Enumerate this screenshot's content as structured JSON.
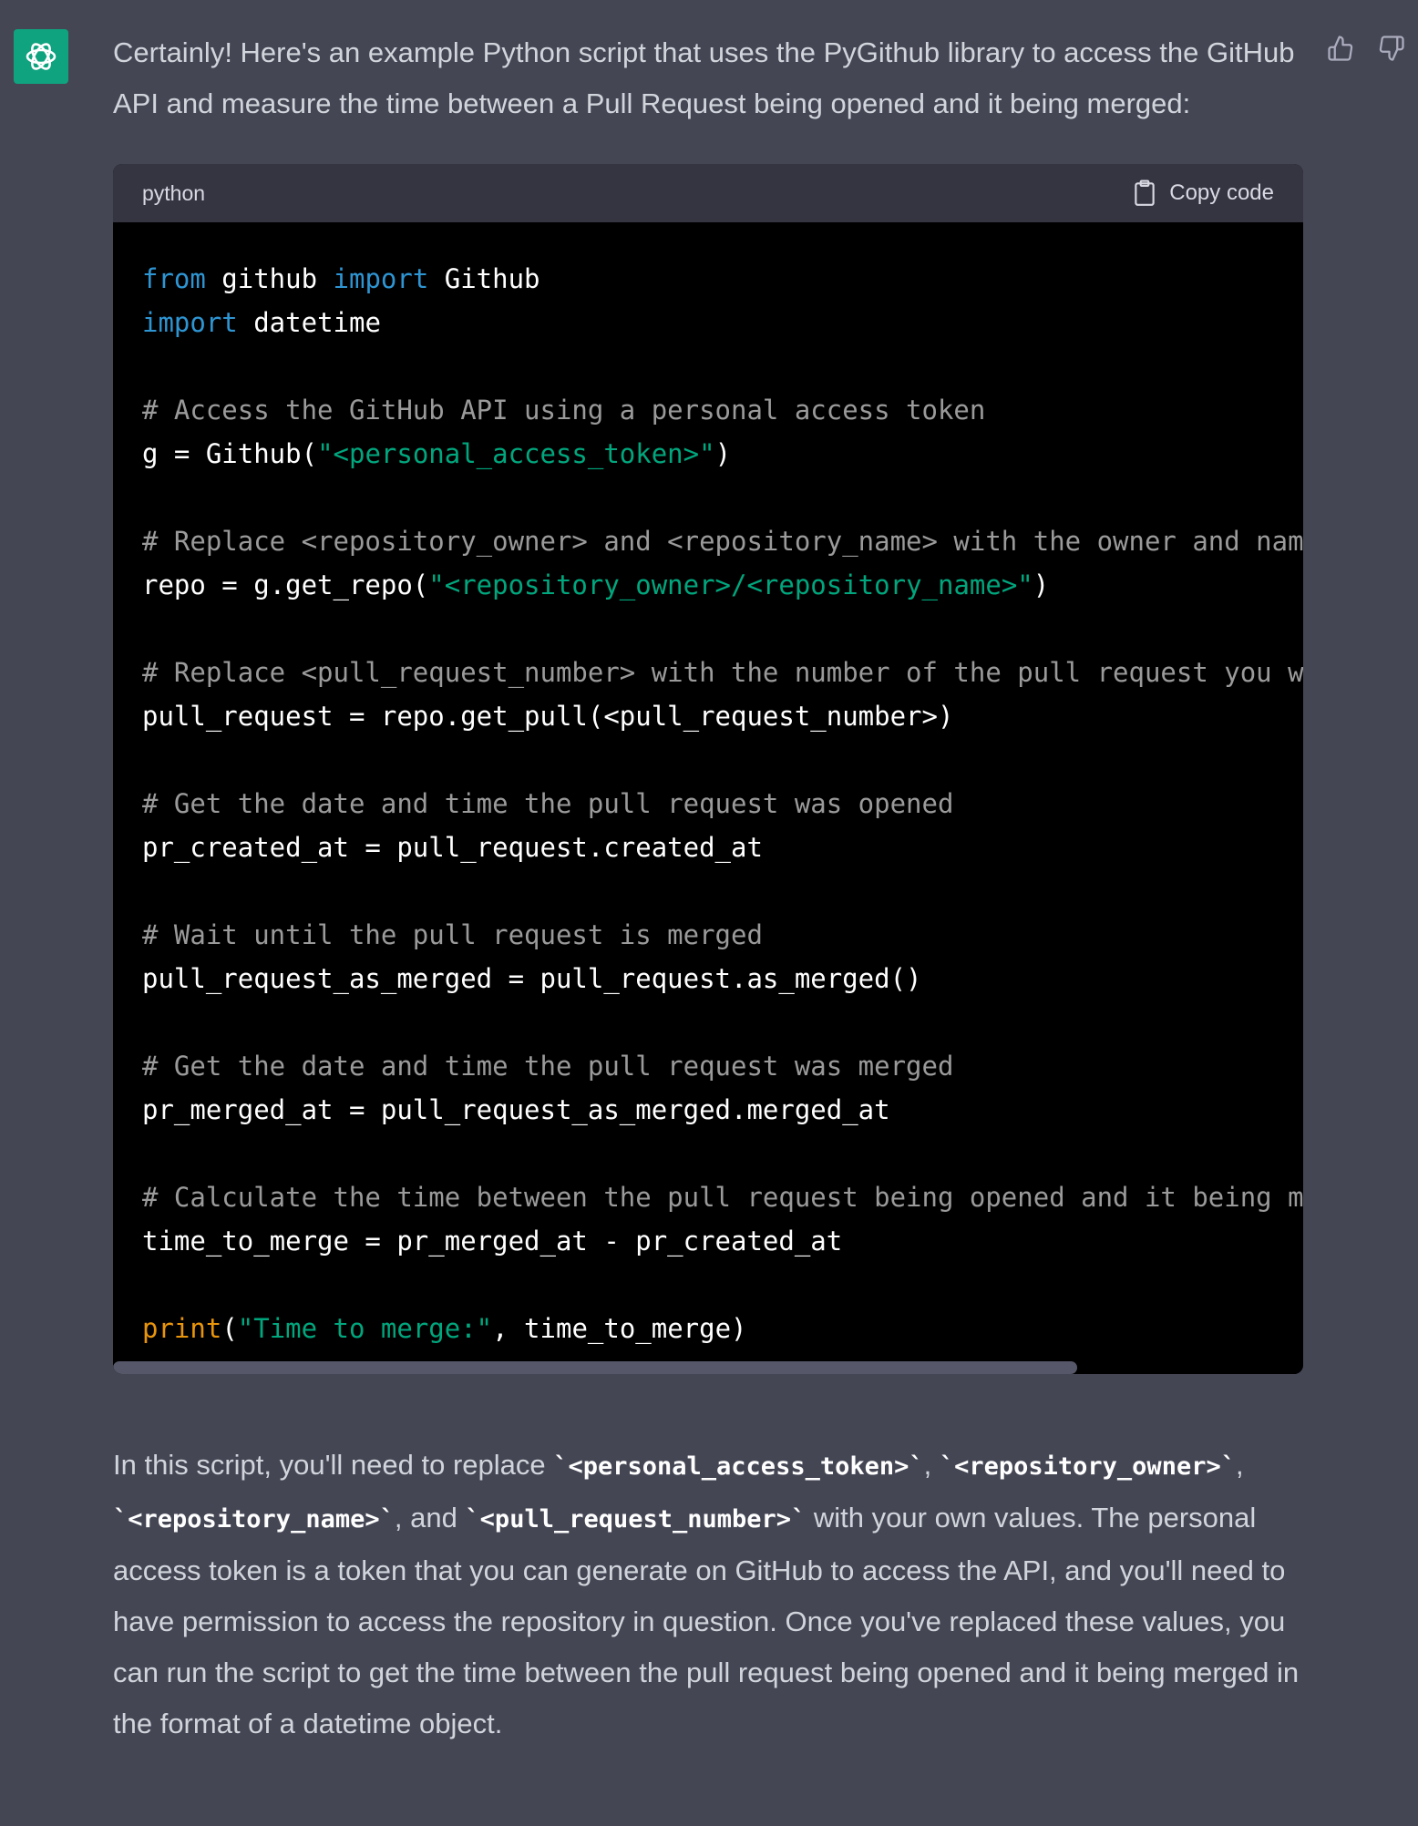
{
  "assistant": {
    "avatar_icon": "openai-logo-icon",
    "accent_color": "#10a37f"
  },
  "feedback": {
    "thumbs_up_icon": "thumbs-up-icon",
    "thumbs_down_icon": "thumbs-down-icon"
  },
  "message": {
    "intro": "Certainly! Here's an example Python script that uses the PyGithub library to access the GitHub API and measure the time between a Pull Request being opened and it being merged:",
    "code_block": {
      "language": "python",
      "copy_label": "Copy code",
      "lines": [
        [
          {
            "t": "from",
            "c": "kw"
          },
          {
            "t": " github "
          },
          {
            "t": "import",
            "c": "kw"
          },
          {
            "t": " Github"
          }
        ],
        [
          {
            "t": "import",
            "c": "kw"
          },
          {
            "t": " datetime"
          }
        ],
        [],
        [
          {
            "t": "# Access the GitHub API using a personal access token",
            "c": "cm"
          }
        ],
        [
          {
            "t": "g = Github("
          },
          {
            "t": "\"<personal_access_token>\"",
            "c": "st"
          },
          {
            "t": ")"
          }
        ],
        [],
        [
          {
            "t": "# Replace <repository_owner> and <repository_name> with the owner and name o",
            "c": "cm"
          }
        ],
        [
          {
            "t": "repo = g.get_repo("
          },
          {
            "t": "\"<repository_owner>/<repository_name>\"",
            "c": "st"
          },
          {
            "t": ")"
          }
        ],
        [],
        [
          {
            "t": "# Replace <pull_request_number> with the number of the pull request you want",
            "c": "cm"
          }
        ],
        [
          {
            "t": "pull_request = repo.get_pull(<pull_request_number>)"
          }
        ],
        [],
        [
          {
            "t": "# Get the date and time the pull request was opened",
            "c": "cm"
          }
        ],
        [
          {
            "t": "pr_created_at = pull_request.created_at"
          }
        ],
        [],
        [
          {
            "t": "# Wait until the pull request is merged",
            "c": "cm"
          }
        ],
        [
          {
            "t": "pull_request_as_merged = pull_request.as_merged()"
          }
        ],
        [],
        [
          {
            "t": "# Get the date and time the pull request was merged",
            "c": "cm"
          }
        ],
        [
          {
            "t": "pr_merged_at = pull_request_as_merged.merged_at"
          }
        ],
        [],
        [
          {
            "t": "# Calculate the time between the pull request being opened and it being merg",
            "c": "cm"
          }
        ],
        [
          {
            "t": "time_to_merge = pr_merged_at - pr_created_at"
          }
        ],
        [],
        [
          {
            "t": "print",
            "c": "bi"
          },
          {
            "t": "("
          },
          {
            "t": "\"Time to merge:\"",
            "c": "st"
          },
          {
            "t": ", time_to_merge)"
          }
        ]
      ]
    },
    "outro": {
      "part1": "In this script, you'll need to replace ",
      "code1": "`<personal_access_token>`",
      "part2": ", ",
      "code2": "`<repository_owner>`",
      "part3": ", ",
      "code3": "`<repository_name>`",
      "part4": ", and ",
      "code4": "`<pull_request_number>`",
      "part5": " with your own values. The personal access token is a token that you can generate on GitHub to access the API, and you'll need to have permission to access the repository in question. Once you've replaced these values, you can run the script to get the time between the pull request being opened and it being merged in the format of a datetime object."
    }
  }
}
